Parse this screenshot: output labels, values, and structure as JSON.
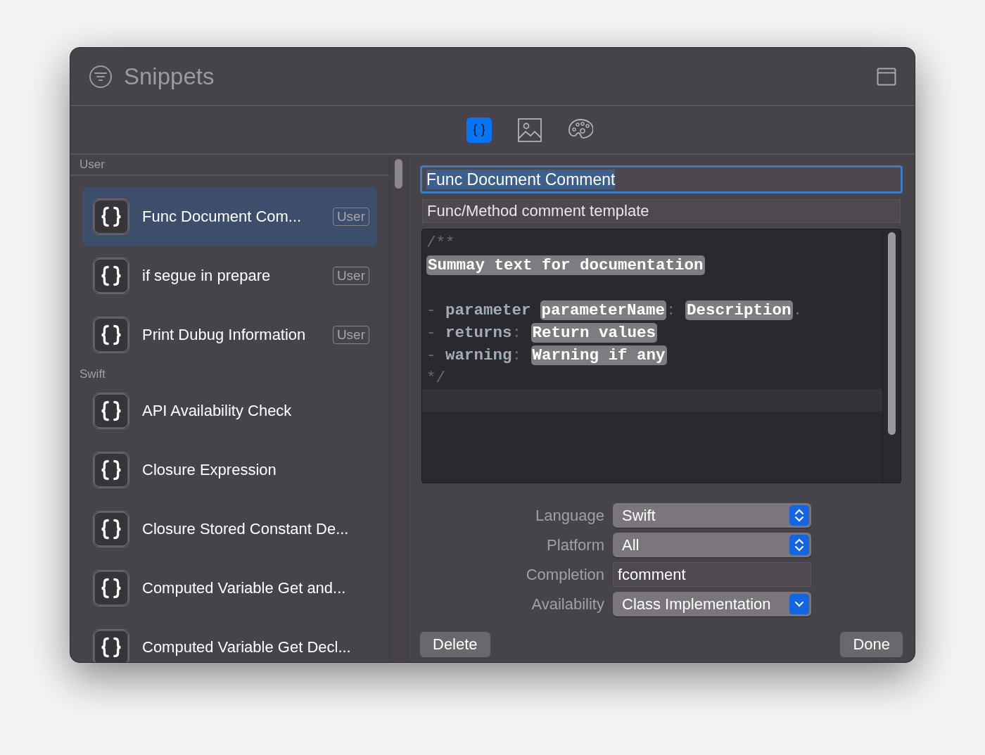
{
  "window": {
    "title": "Snippets"
  },
  "tabs": [
    {
      "kind": "code",
      "selected": true
    },
    {
      "kind": "image",
      "selected": false
    },
    {
      "kind": "palette",
      "selected": false
    }
  ],
  "sidebar": {
    "sections": [
      {
        "title": "User",
        "items": [
          {
            "title": "Func Document Com...",
            "badge": "User",
            "selected": true
          },
          {
            "title": "if segue in prepare",
            "badge": "User",
            "selected": false
          },
          {
            "title": "Print Dubug Information",
            "badge": "User",
            "selected": false
          }
        ]
      },
      {
        "title": "Swift",
        "items": [
          {
            "title": "API Availability Check",
            "selected": false
          },
          {
            "title": "Closure Expression",
            "selected": false
          },
          {
            "title": "Closure Stored Constant De...",
            "selected": false
          },
          {
            "title": "Computed Variable Get and...",
            "selected": false
          },
          {
            "title": "Computed Variable Get Decl...",
            "selected": false
          }
        ]
      }
    ]
  },
  "editor": {
    "name": {
      "value": "Func Document Comment"
    },
    "summary": {
      "value": "Func/Method comment template"
    },
    "code_lines": [
      {
        "kind": "code",
        "tokens": [
          {
            "kind": "comment",
            "text": "/**"
          }
        ]
      },
      {
        "kind": "code",
        "tokens": [
          {
            "kind": "placeholder",
            "text": "Summay text for documentation"
          }
        ]
      },
      {
        "kind": "blank"
      },
      {
        "kind": "code",
        "tokens": [
          {
            "kind": "comment",
            "text": "- "
          },
          {
            "kind": "keyword",
            "text": "parameter"
          },
          {
            "kind": "placeholder",
            "text": "parameterName"
          },
          {
            "kind": "comment",
            "text": ": "
          },
          {
            "kind": "placeholder",
            "text": "Description"
          },
          {
            "kind": "comment",
            "text": "."
          }
        ]
      },
      {
        "kind": "code",
        "tokens": [
          {
            "kind": "comment",
            "text": "- "
          },
          {
            "kind": "keyword",
            "text": "returns"
          },
          {
            "kind": "comment",
            "text": ": "
          },
          {
            "kind": "placeholder",
            "text": "Return values"
          }
        ]
      },
      {
        "kind": "code",
        "tokens": [
          {
            "kind": "comment",
            "text": "- "
          },
          {
            "kind": "keyword",
            "text": "warning"
          },
          {
            "kind": "comment",
            "text": ": "
          },
          {
            "kind": "placeholder",
            "text": "Warning if any"
          }
        ]
      },
      {
        "kind": "code",
        "tokens": [
          {
            "kind": "comment",
            "text": "*/"
          }
        ]
      }
    ],
    "settings": [
      {
        "label": "Language",
        "kind": "popup",
        "value": "Swift"
      },
      {
        "label": "Platform",
        "kind": "popup",
        "value": "All"
      },
      {
        "label": "Completion",
        "kind": "text",
        "value": "fcomment"
      },
      {
        "label": "Availability",
        "kind": "pulldown",
        "value": "Class Implementation"
      }
    ]
  },
  "buttons": [
    {
      "label": "Delete"
    },
    {
      "label": "Done"
    }
  ]
}
